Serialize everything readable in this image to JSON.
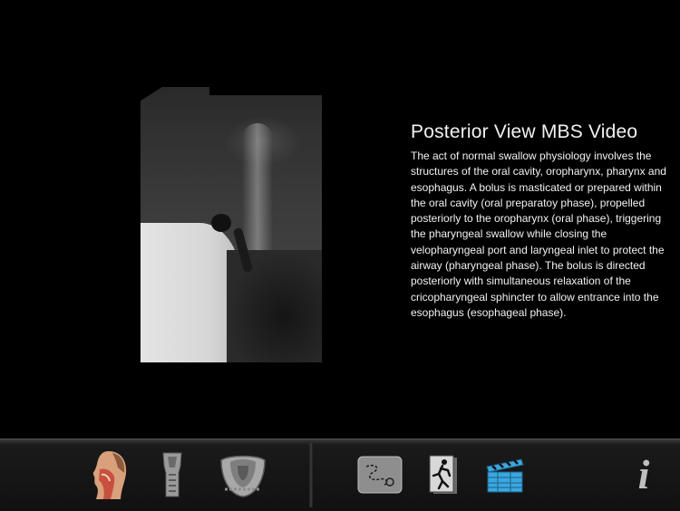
{
  "content": {
    "title": "Posterior View MBS Video",
    "description": "The act of normal swallow physiology involves the structures of the oral cavity, oropharynx, pharynx and esophagus.  A bolus is masticated or prepared within the oral cavity (oral preparatoy phase), propelled posteriorly to the oropharynx (oral phase), triggering the pharyngeal swallow while closing the velopharyngeal port and laryngeal inlet to protect the airway (pharyngeal phase). The bolus is directed posteriorly with simultaneous relaxation of the cricopharyngeal sphincter to allow entrance into the esophagus (esophageal phase)."
  },
  "toolbar": {
    "left_icons": [
      "head-anatomy-icon",
      "larynx-icon",
      "airway-bowl-icon"
    ],
    "right_icons": [
      "scribble-icon",
      "running-figure-icon",
      "clapperboard-icon"
    ],
    "info_label": "i"
  },
  "colors": {
    "background": "#000000",
    "text": "#f2f2f2",
    "toolbar": "#1a1a1a",
    "clapper_blue": "#3aa7e0"
  }
}
